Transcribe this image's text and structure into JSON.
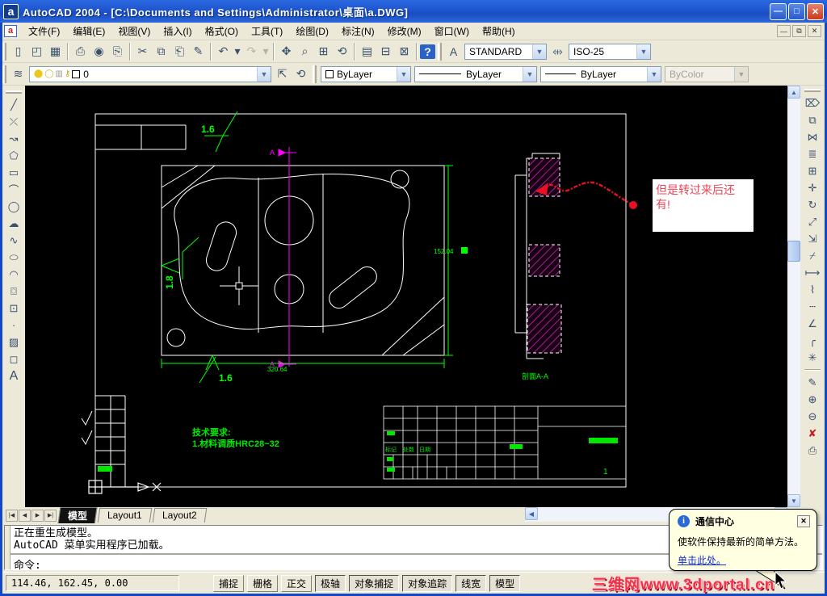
{
  "window": {
    "title": "AutoCAD 2004 - [C:\\Documents and Settings\\Administrator\\桌面\\a.DWG]",
    "icon_letter": "a",
    "dwg_icon_letter": "a",
    "controls": {
      "minimize": "—",
      "maximize": "□",
      "close": "✕"
    },
    "mdi_controls": {
      "minimize": "—",
      "restore": "⧉",
      "close": "✕"
    }
  },
  "menubar": {
    "items": [
      "文件(F)",
      "编辑(E)",
      "视图(V)",
      "插入(I)",
      "格式(O)",
      "工具(T)",
      "绘图(D)",
      "标注(N)",
      "修改(M)",
      "窗口(W)",
      "帮助(H)"
    ]
  },
  "toolbars": {
    "standard": [
      {
        "name": "new",
        "glyph": "▯"
      },
      {
        "name": "open",
        "glyph": "◰"
      },
      {
        "name": "save",
        "glyph": "▦"
      },
      {
        "name": "plot",
        "glyph": "⎙"
      },
      {
        "name": "plot-preview",
        "glyph": "◉"
      },
      {
        "name": "publish",
        "glyph": "⎘"
      },
      {
        "name": "cut",
        "glyph": "✂"
      },
      {
        "name": "copy-clip",
        "glyph": "⧉"
      },
      {
        "name": "paste",
        "glyph": "⎗"
      },
      {
        "name": "match-properties",
        "glyph": "✎"
      },
      {
        "name": "undo",
        "glyph": "↶"
      },
      {
        "name": "undo-drop",
        "glyph": "▾"
      },
      {
        "name": "redo",
        "glyph": "↷"
      },
      {
        "name": "redo-drop",
        "glyph": "▾"
      },
      {
        "name": "pan",
        "glyph": "✥"
      },
      {
        "name": "zoom-realtime",
        "glyph": "⌕"
      },
      {
        "name": "zoom-window",
        "glyph": "⊞"
      },
      {
        "name": "zoom-previous",
        "glyph": "⟲"
      },
      {
        "name": "properties",
        "glyph": "▤"
      },
      {
        "name": "designcenter",
        "glyph": "⊟"
      },
      {
        "name": "tool-palettes",
        "glyph": "⊠"
      },
      {
        "name": "help",
        "glyph": "?"
      }
    ],
    "styles": {
      "text_style_value": "STANDARD",
      "dim_style_value": "ISO-25",
      "text_style_icon": "A",
      "dim_style_icon": "⤄",
      "dropdown_arrow": "▼"
    },
    "layers": {
      "layers_icon": "≋",
      "layer_prev_icon": "⇱",
      "layer_states_icon": "⟲",
      "bulb_icon": "⬤",
      "sun_icon": "◯",
      "plot_icon": "▥",
      "lock_icon": "⚷",
      "current_layer": "0",
      "color_value": "ByLayer",
      "linetype_value": "ByLayer",
      "lineweight_value": "ByLayer",
      "plotstyle_value": "ByColor",
      "dropdown_arrow": "▼"
    },
    "draw": [
      {
        "name": "line",
        "glyph": "╱"
      },
      {
        "name": "construction-line",
        "glyph": "⤫"
      },
      {
        "name": "polyline",
        "glyph": "↝"
      },
      {
        "name": "polygon",
        "glyph": "⬠"
      },
      {
        "name": "rectangle",
        "glyph": "▭"
      },
      {
        "name": "arc",
        "glyph": "⌒"
      },
      {
        "name": "circle",
        "glyph": "◯"
      },
      {
        "name": "revision-cloud",
        "glyph": "☁"
      },
      {
        "name": "spline",
        "glyph": "∿"
      },
      {
        "name": "ellipse",
        "glyph": "⬭"
      },
      {
        "name": "ellipse-arc",
        "glyph": "◠"
      },
      {
        "name": "insert-block",
        "glyph": "⌼"
      },
      {
        "name": "make-block",
        "glyph": "⊡"
      },
      {
        "name": "point",
        "glyph": "∙"
      },
      {
        "name": "hatch",
        "glyph": "▨"
      },
      {
        "name": "region",
        "glyph": "◻"
      },
      {
        "name": "text",
        "glyph": "A"
      }
    ],
    "modify": [
      {
        "name": "erase",
        "glyph": "⌦"
      },
      {
        "name": "copy",
        "glyph": "⧉"
      },
      {
        "name": "mirror",
        "glyph": "⋈"
      },
      {
        "name": "offset",
        "glyph": "≣"
      },
      {
        "name": "array",
        "glyph": "⊞"
      },
      {
        "name": "move",
        "glyph": "✛"
      },
      {
        "name": "rotate",
        "glyph": "↻"
      },
      {
        "name": "scale",
        "glyph": "⤢"
      },
      {
        "name": "stretch",
        "glyph": "⇲"
      },
      {
        "name": "trim",
        "glyph": "⌿"
      },
      {
        "name": "extend",
        "glyph": "⟼"
      },
      {
        "name": "break-at-point",
        "glyph": "⌇"
      },
      {
        "name": "break",
        "glyph": "┄"
      },
      {
        "name": "chamfer",
        "glyph": "∠"
      },
      {
        "name": "fillet",
        "glyph": "╭"
      },
      {
        "name": "explode",
        "glyph": "✳"
      }
    ],
    "refedit": [
      {
        "name": "edit-reference",
        "glyph": "✎"
      },
      {
        "name": "add-objects",
        "glyph": "⊕"
      },
      {
        "name": "remove-objects",
        "glyph": "⊖"
      },
      {
        "name": "discard-edits",
        "glyph": "✘"
      },
      {
        "name": "save-edits",
        "glyph": "⎙"
      }
    ]
  },
  "drawing": {
    "note_line1": "但是转过来后还",
    "note_line2": "有!",
    "surface_top": "1.6",
    "surface_left": "1.8",
    "surface_bottom": "1.6",
    "section_marker_top": "A",
    "section_marker_bottom": "A",
    "dim_right": "152.04",
    "dim_bottom": "320.64",
    "tech_line1": "技术要求:",
    "tech_line2": "1.材料调质HRC28~32",
    "section_label": "剖面A-A",
    "title_block": {
      "label1": "标记",
      "label2": "处数",
      "label3": "日期",
      "sheet_no": "1"
    }
  },
  "tabs": {
    "nav": [
      "|◀",
      "◀",
      "▶",
      "▶|"
    ],
    "items": [
      "模型",
      "Layout1",
      "Layout2"
    ],
    "active": "模型"
  },
  "scroll": {
    "up": "▲",
    "down": "▼",
    "left": "◀",
    "right": "▶"
  },
  "command": {
    "line1": "正在重生成模型。",
    "line2": "AutoCAD 菜单实用程序已加载。",
    "prompt": "命令:"
  },
  "statusbar": {
    "coords": "114.46, 162.45, 0.00",
    "buttons": [
      {
        "label": "捕捉",
        "pressed": false
      },
      {
        "label": "栅格",
        "pressed": false
      },
      {
        "label": "正交",
        "pressed": false
      },
      {
        "label": "极轴",
        "pressed": true
      },
      {
        "label": "对象捕捉",
        "pressed": true
      },
      {
        "label": "对象追踪",
        "pressed": true
      },
      {
        "label": "线宽",
        "pressed": true
      },
      {
        "label": "模型",
        "pressed": true
      }
    ]
  },
  "balloon": {
    "title": "通信中心",
    "info_glyph": "i",
    "close_glyph": "✕",
    "body": "使软件保持最新的简单方法。",
    "link": "单击此处。"
  },
  "watermark": "三维网www.3dportal.cn",
  "colors": {
    "cad_white": "#FFFFFF",
    "cad_green": "#00FF00",
    "cad_magenta": "#FF00FF",
    "annotation_red": "#E8475A",
    "balloon_bg": "#FFFFE1",
    "titlebar_blue": "#1E55CE"
  }
}
